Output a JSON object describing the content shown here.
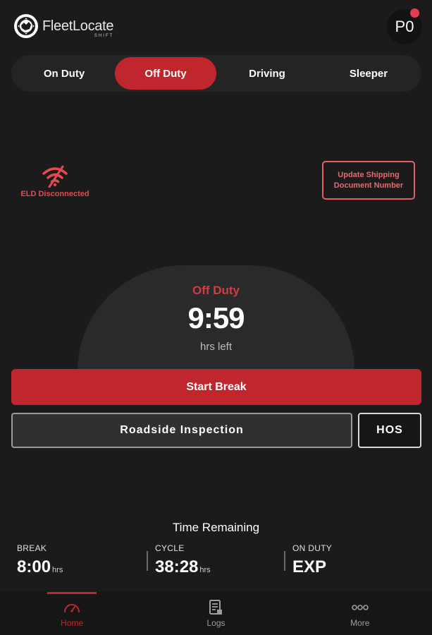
{
  "header": {
    "brand": "FleetLocate",
    "brand_sub": "SHIFT",
    "avatar_initials": "P0",
    "accent": "#c0262d",
    "notification_dot": "#e23f57"
  },
  "status_tabs": [
    {
      "label": "On Duty",
      "active": false
    },
    {
      "label": "Off Duty",
      "active": true
    },
    {
      "label": "Driving",
      "active": false
    },
    {
      "label": "Sleeper",
      "active": false
    }
  ],
  "eld": {
    "label": "ELD Disconnected",
    "icon": "wifi-off-icon"
  },
  "update_shipping": {
    "line1": "Update Shipping",
    "line2": "Document Number"
  },
  "dial": {
    "status": "Off Duty",
    "time": "9:59",
    "sub": "hrs left"
  },
  "actions": {
    "start_break": "Start Break",
    "roadside": "Roadside Inspection",
    "hos": "HOS"
  },
  "time_remaining": {
    "title": "Time Remaining",
    "items": [
      {
        "label": "BREAK",
        "value": "8:00",
        "unit": "hrs"
      },
      {
        "label": "CYCLE",
        "value": "38:28",
        "unit": "hrs"
      },
      {
        "label": "ON DUTY",
        "value": "EXP",
        "unit": ""
      }
    ]
  },
  "nav": [
    {
      "label": "Home",
      "icon": "speedometer-icon",
      "active": true
    },
    {
      "label": "Logs",
      "icon": "document-icon",
      "active": false
    },
    {
      "label": "More",
      "icon": "more-dots-icon",
      "active": false
    }
  ]
}
